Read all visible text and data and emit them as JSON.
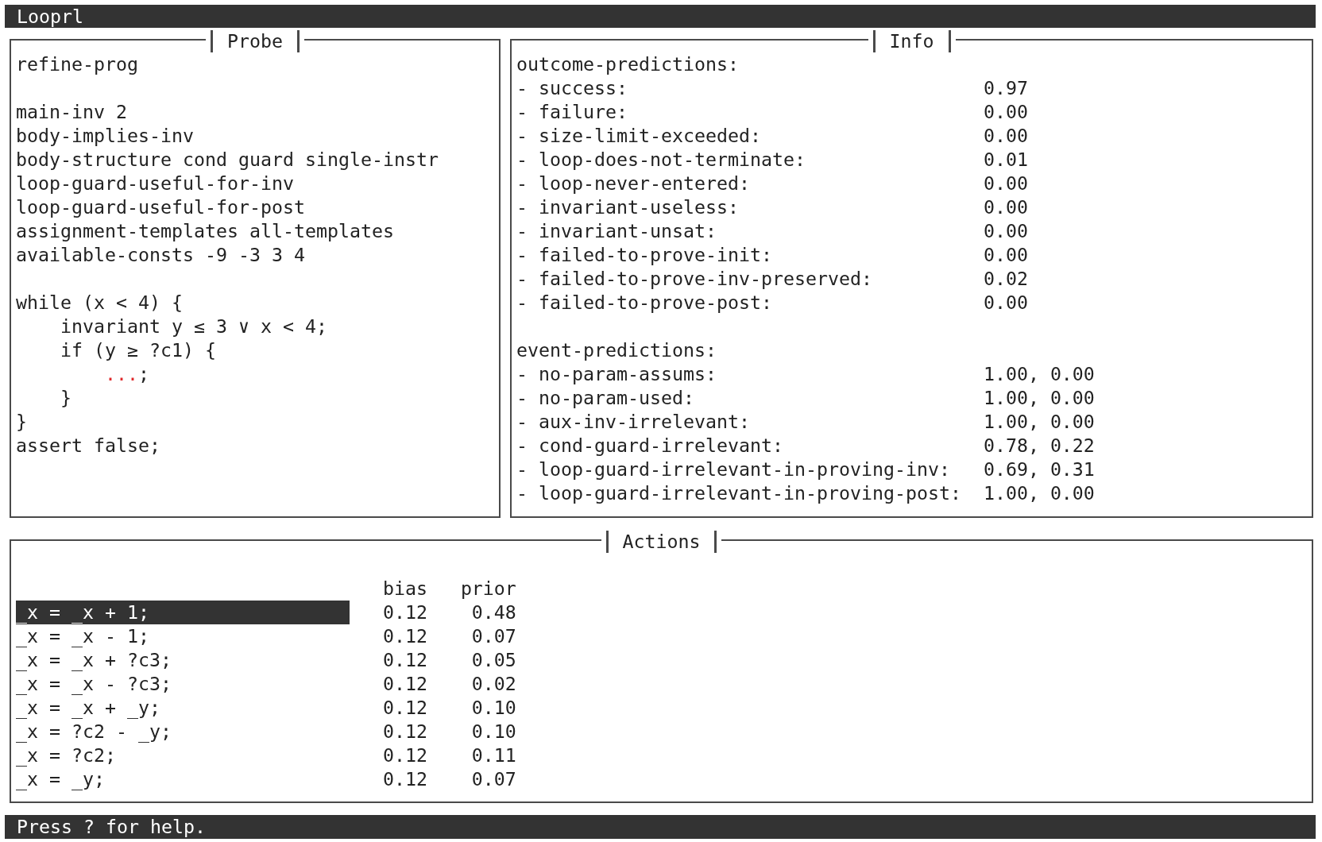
{
  "window": {
    "title": "Looprl"
  },
  "probe": {
    "title": "Probe",
    "sections": [
      {
        "lines": [
          "refine-prog"
        ]
      },
      {
        "lines": [
          "main-inv 2",
          "body-implies-inv",
          "body-structure cond guard single-instr",
          "loop-guard-useful-for-inv",
          "loop-guard-useful-for-post",
          "assignment-templates all-templates",
          "available-consts -9 -3 3 4"
        ]
      }
    ],
    "code": [
      {
        "kind": "line",
        "text": "while (x < 4) {",
        "children": [
          {
            "kind": "line",
            "text": "invariant y ≤ 3 ∨ x < 4;"
          },
          {
            "kind": "line",
            "text": "if (y ≥ ?c1) {",
            "children": [
              {
                "kind": "hole",
                "hole": "...",
                "text": ";"
              }
            ]
          },
          {
            "kind": "line",
            "text": "}"
          }
        ]
      },
      {
        "kind": "line",
        "text": "}"
      },
      {
        "kind": "line",
        "text": "assert false;"
      }
    ]
  },
  "info": {
    "title": "Info",
    "groups": [
      {
        "heading": "outcome-predictions:",
        "rows": [
          {
            "label": "- success:",
            "value": "0.97"
          },
          {
            "label": "- failure:",
            "value": "0.00"
          },
          {
            "label": "- size-limit-exceeded:",
            "value": "0.00"
          },
          {
            "label": "- loop-does-not-terminate:",
            "value": "0.01"
          },
          {
            "label": "- loop-never-entered:",
            "value": "0.00"
          },
          {
            "label": "- invariant-useless:",
            "value": "0.00"
          },
          {
            "label": "- invariant-unsat:",
            "value": "0.00"
          },
          {
            "label": "- failed-to-prove-init:",
            "value": "0.00"
          },
          {
            "label": "- failed-to-prove-inv-preserved:",
            "value": "0.02"
          },
          {
            "label": "- failed-to-prove-post:",
            "value": "0.00"
          }
        ]
      },
      {
        "heading": "event-predictions:",
        "rows": [
          {
            "label": "- no-param-assums:",
            "value": "1.00, 0.00"
          },
          {
            "label": "- no-param-used:",
            "value": "1.00, 0.00"
          },
          {
            "label": "- aux-inv-irrelevant:",
            "value": "1.00, 0.00"
          },
          {
            "label": "- cond-guard-irrelevant:",
            "value": "0.78, 0.22"
          },
          {
            "label": "- loop-guard-irrelevant-in-proving-inv:",
            "value": "0.69, 0.31"
          },
          {
            "label": "- loop-guard-irrelevant-in-proving-post:",
            "value": "1.00, 0.00"
          }
        ]
      }
    ]
  },
  "actions": {
    "title": "Actions",
    "columns": [
      "bias",
      "prior"
    ],
    "rows": [
      {
        "action": "_x = _x + 1;",
        "bias": "0.12",
        "prior": "0.48",
        "selected": true
      },
      {
        "action": "_x = _x - 1;",
        "bias": "0.12",
        "prior": "0.07",
        "selected": false
      },
      {
        "action": "_x = _x + ?c3;",
        "bias": "0.12",
        "prior": "0.05",
        "selected": false
      },
      {
        "action": "_x = _x - ?c3;",
        "bias": "0.12",
        "prior": "0.02",
        "selected": false
      },
      {
        "action": "_x = _x + _y;",
        "bias": "0.12",
        "prior": "0.10",
        "selected": false
      },
      {
        "action": "_x = ?c2 - _y;",
        "bias": "0.12",
        "prior": "0.10",
        "selected": false
      },
      {
        "action": "_x = ?c2;",
        "bias": "0.12",
        "prior": "0.11",
        "selected": false
      },
      {
        "action": "_x = _y;",
        "bias": "0.12",
        "prior": "0.07",
        "selected": false
      }
    ]
  },
  "status_bar": {
    "text": "Press ? for help."
  }
}
